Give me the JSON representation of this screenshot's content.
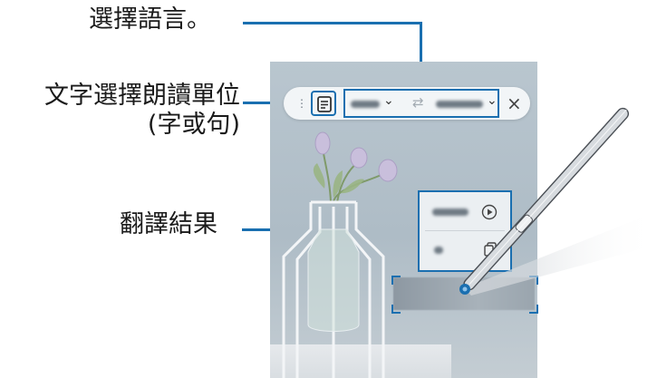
{
  "callouts": {
    "select_language": "選擇語言。",
    "reading_unit_line1": "文字選擇朗讀單位",
    "reading_unit_line2": "(字或句)",
    "translation_result": "翻譯結果"
  },
  "toolbar": {
    "close_symbol": "×",
    "swap_symbol": "⇄",
    "chevron": "⌄"
  },
  "colors": {
    "accent": "#1a6fb0",
    "pen_body": "#c9ced3"
  },
  "icons": [
    "text-unit-icon",
    "chevron-down-icon",
    "swap-icon",
    "close-icon",
    "play-icon",
    "copy-icon"
  ]
}
